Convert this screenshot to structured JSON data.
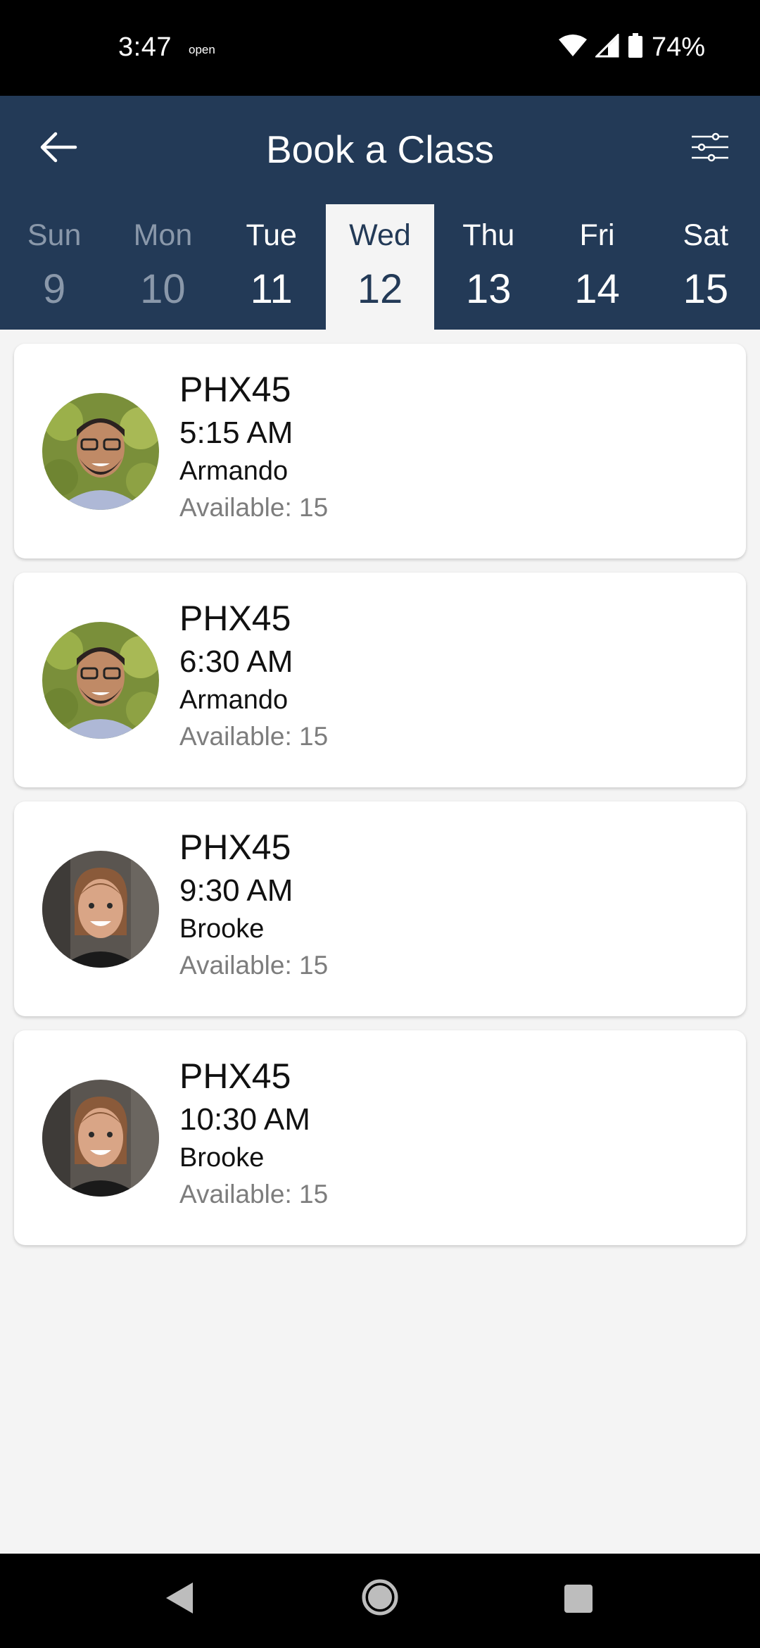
{
  "status_bar": {
    "time": "3:47",
    "open_label": "open",
    "battery": "74%",
    "icons": [
      "wifi-icon",
      "signal-icon",
      "battery-icon"
    ]
  },
  "header": {
    "title": "Book a Class",
    "back_icon": "arrow-left-icon",
    "filter_icon": "sliders-icon",
    "background": "#233a57"
  },
  "days": [
    {
      "name": "Sun",
      "num": "9"
    },
    {
      "name": "Mon",
      "num": "10"
    },
    {
      "name": "Tue",
      "num": "11"
    },
    {
      "name": "Wed",
      "num": "12"
    },
    {
      "name": "Thu",
      "num": "13"
    },
    {
      "name": "Fri",
      "num": "14"
    },
    {
      "name": "Sat",
      "num": "15"
    }
  ],
  "selected_day": "Wed",
  "classes": [
    {
      "name": "PHX45",
      "time": "5:15 AM",
      "instructor": "Armando",
      "available": "Available: 15"
    },
    {
      "name": "PHX45",
      "time": "6:30 AM",
      "instructor": "Armando",
      "available": "Available: 15"
    },
    {
      "name": "PHX45",
      "time": "9:30 AM",
      "instructor": "Brooke",
      "available": "Available: 15"
    },
    {
      "name": "PHX45",
      "time": "10:30 AM",
      "instructor": "Brooke",
      "available": "Available: 15"
    }
  ],
  "nav_bar": {
    "icons": [
      "back-triangle-icon",
      "home-circle-icon",
      "recents-square-icon"
    ]
  }
}
